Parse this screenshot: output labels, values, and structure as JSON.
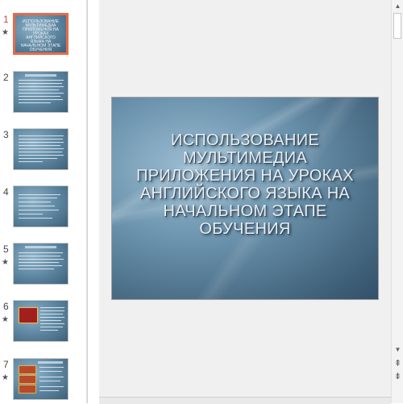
{
  "slides": [
    {
      "number": "1",
      "has_animation": true,
      "selected": true
    },
    {
      "number": "2",
      "has_animation": false,
      "selected": false
    },
    {
      "number": "3",
      "has_animation": false,
      "selected": false
    },
    {
      "number": "4",
      "has_animation": false,
      "selected": false
    },
    {
      "number": "5",
      "has_animation": true,
      "selected": false
    },
    {
      "number": "6",
      "has_animation": true,
      "selected": false
    },
    {
      "number": "7",
      "has_animation": true,
      "selected": false
    }
  ],
  "thumbnail_1_title": "ИСПОЛЬЗОВАНИЕ МУЛЬТИМЕДИА ПРИЛОЖЕНИЯ НА УРОКАХ АНГЛИЙСКОГО ЯЗЫКА НА НАЧАЛЬНОМ ЭТАПЕ ОБУЧЕНИЯ",
  "main_slide": {
    "title": "ИСПОЛЬЗОВАНИЕ МУЛЬТИМЕДИА ПРИЛОЖЕНИЯ НА УРОКАХ АНГЛИЙСКОГО ЯЗЫКА НА НАЧАЛЬНОМ ЭТАПЕ ОБУЧЕНИЯ"
  },
  "animation_marker": "★",
  "icons": {
    "scroll_up": "▲",
    "scroll_down": "▼",
    "prev_slide": "⇞",
    "next_slide": "⇟"
  },
  "colors": {
    "selection_border": "#e46c4a",
    "slide_number_active": "#c0504d",
    "slide_bg_dark": "#3e5f77",
    "slide_bg_light": "#9cbdd2"
  }
}
